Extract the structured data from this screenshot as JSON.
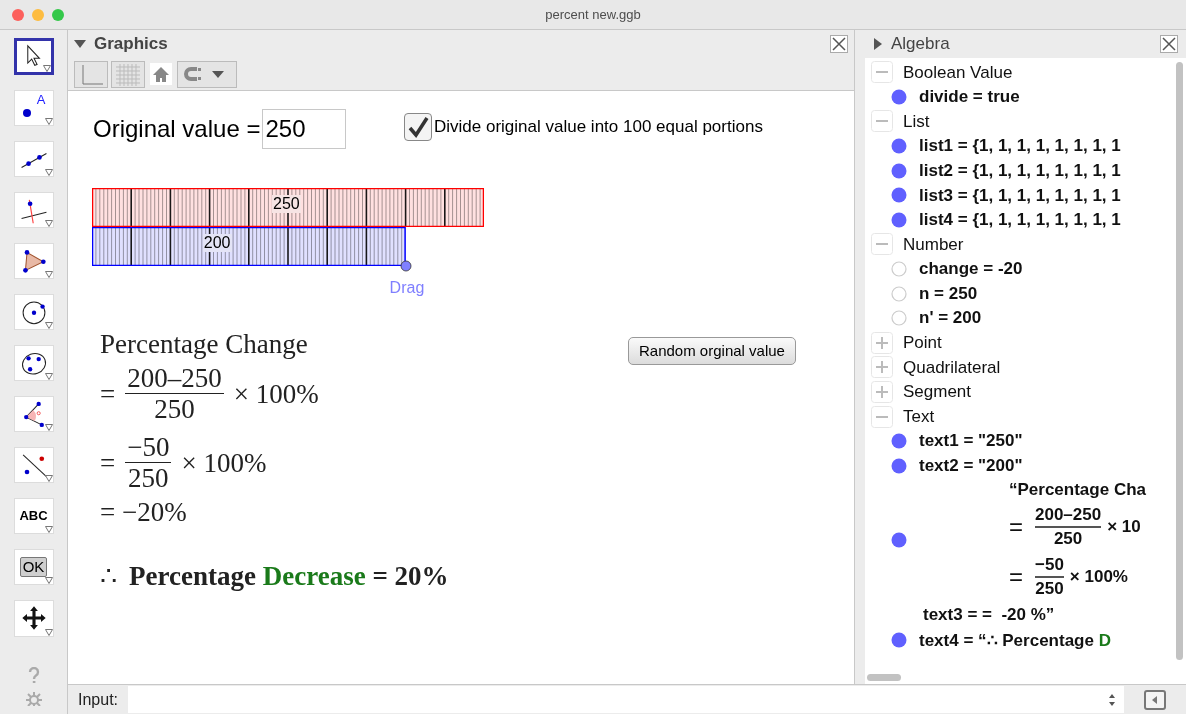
{
  "window": {
    "title": "percent new.ggb"
  },
  "tools": [
    {
      "kind": "move",
      "selected": true
    },
    {
      "kind": "point",
      "label": "A",
      "selected": false
    },
    {
      "kind": "line",
      "selected": false
    },
    {
      "kind": "perpendicular",
      "selected": false
    },
    {
      "kind": "polygon",
      "selected": false
    },
    {
      "kind": "circle",
      "selected": false
    },
    {
      "kind": "ellipse",
      "selected": false
    },
    {
      "kind": "angle",
      "selected": false
    },
    {
      "kind": "reflect",
      "selected": false
    },
    {
      "kind": "text",
      "label": "ABC",
      "selected": false
    },
    {
      "kind": "button",
      "label": "OK",
      "selected": false
    },
    {
      "kind": "pan",
      "selected": false
    }
  ],
  "graphics": {
    "title": "Graphics",
    "original_value": {
      "label": "Original value =",
      "value": "250"
    },
    "checkbox": {
      "label": "Divide original value into 100 equal portions",
      "checked": true
    },
    "bars": [
      {
        "label": "250",
        "color": "#ff0000"
      },
      {
        "label": "200",
        "color": "#0000ff"
      }
    ],
    "drag_label": "Drag",
    "random_button": "Random orginal value",
    "working": [
      {
        "kind": "text",
        "text": "Percentage Change"
      },
      {
        "kind": "fraction",
        "prefix": "=",
        "numerator": "200–250",
        "denominator": "250",
        "suffix": "× 100%"
      },
      {
        "kind": "fraction",
        "prefix": "=",
        "numerator": "−50",
        "denominator": "250",
        "suffix": "× 100%"
      },
      {
        "kind": "text",
        "text": "= −20%"
      }
    ],
    "conclusion": {
      "symbol": "∴",
      "before": "Percentage",
      "highlight": "Decrease",
      "after": "= 20%"
    }
  },
  "algebra": {
    "title": "Algebra",
    "groups": [
      {
        "label": "Boolean Value",
        "expanded": true,
        "items": [
          {
            "kind": "plain",
            "text": "divide = true",
            "visible": true
          }
        ]
      },
      {
        "label": "List",
        "expanded": true,
        "items": [
          {
            "kind": "plain",
            "text": "list1 = {1, 1, 1, 1, 1, 1, 1, 1",
            "visible": true
          },
          {
            "kind": "plain",
            "text": "list2 = {1, 1, 1, 1, 1, 1, 1, 1",
            "visible": true
          },
          {
            "kind": "plain",
            "text": "list3 = {1, 1, 1, 1, 1, 1, 1, 1",
            "visible": true
          },
          {
            "kind": "plain",
            "text": "list4 = {1, 1, 1, 1, 1, 1, 1, 1",
            "visible": true
          }
        ]
      },
      {
        "label": "Number",
        "expanded": true,
        "items": [
          {
            "kind": "plain",
            "text": "change = -20",
            "visible": false
          },
          {
            "kind": "plain",
            "text": "n = 250",
            "visible": false
          },
          {
            "kind": "plain",
            "text": "n' = 200",
            "visible": false
          }
        ]
      },
      {
        "label": "Point",
        "expanded": false
      },
      {
        "label": "Quadrilateral",
        "expanded": false
      },
      {
        "label": "Segment",
        "expanded": false
      },
      {
        "label": "Text",
        "expanded": true,
        "items": [
          {
            "kind": "plain",
            "text": "text1 = \"250\"",
            "visible": true
          },
          {
            "kind": "plain",
            "text": "text2 = \"200\"",
            "visible": true
          },
          {
            "kind": "formula",
            "visible": true,
            "heading": "“Percentage Cha",
            "fractions": [
              {
                "prefix": "=",
                "numerator": "200–250",
                "denominator": "250",
                "suffix": "× 10"
              },
              {
                "prefix": "=",
                "numerator": "−50",
                "denominator": "250",
                "suffix": "× 100%"
              }
            ],
            "tail": "text3 = =  -20 %”"
          },
          {
            "kind": "colored",
            "text": "text4 = “∴ Percentage",
            "highlight": "D",
            "visible": true
          }
        ]
      }
    ]
  },
  "input_bar": {
    "label": "Input:"
  }
}
